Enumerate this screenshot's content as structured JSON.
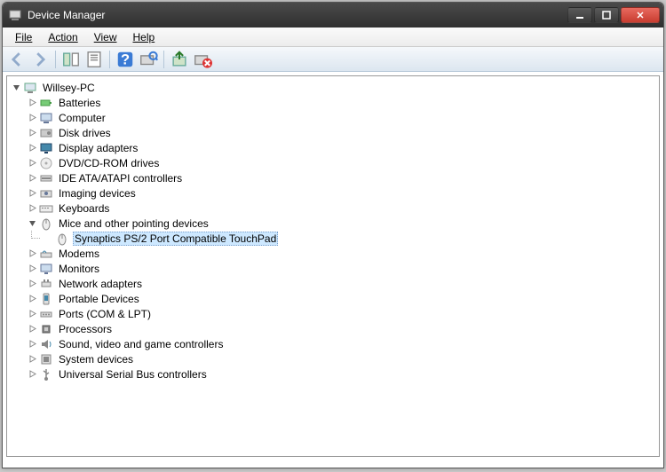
{
  "window": {
    "title": "Device Manager"
  },
  "menu": {
    "file": "File",
    "action": "Action",
    "view": "View",
    "help": "Help"
  },
  "tree": {
    "root": "Willsey-PC",
    "items": [
      {
        "label": "Batteries",
        "icon": "battery"
      },
      {
        "label": "Computer",
        "icon": "computer"
      },
      {
        "label": "Disk drives",
        "icon": "disk"
      },
      {
        "label": "Display adapters",
        "icon": "display"
      },
      {
        "label": "DVD/CD-ROM drives",
        "icon": "dvd"
      },
      {
        "label": "IDE ATA/ATAPI controllers",
        "icon": "ide"
      },
      {
        "label": "Imaging devices",
        "icon": "imaging"
      },
      {
        "label": "Keyboards",
        "icon": "keyboard"
      },
      {
        "label": "Mice and other pointing devices",
        "icon": "mouse",
        "expanded": true,
        "children": [
          {
            "label": "Synaptics PS/2 Port Compatible TouchPad",
            "icon": "mouse",
            "selected": true
          }
        ]
      },
      {
        "label": "Modems",
        "icon": "modem"
      },
      {
        "label": "Monitors",
        "icon": "monitor"
      },
      {
        "label": "Network adapters",
        "icon": "network"
      },
      {
        "label": "Portable Devices",
        "icon": "portable"
      },
      {
        "label": "Ports (COM & LPT)",
        "icon": "port"
      },
      {
        "label": "Processors",
        "icon": "cpu"
      },
      {
        "label": "Sound, video and game controllers",
        "icon": "sound"
      },
      {
        "label": "System devices",
        "icon": "system"
      },
      {
        "label": "Universal Serial Bus controllers",
        "icon": "usb"
      }
    ]
  }
}
